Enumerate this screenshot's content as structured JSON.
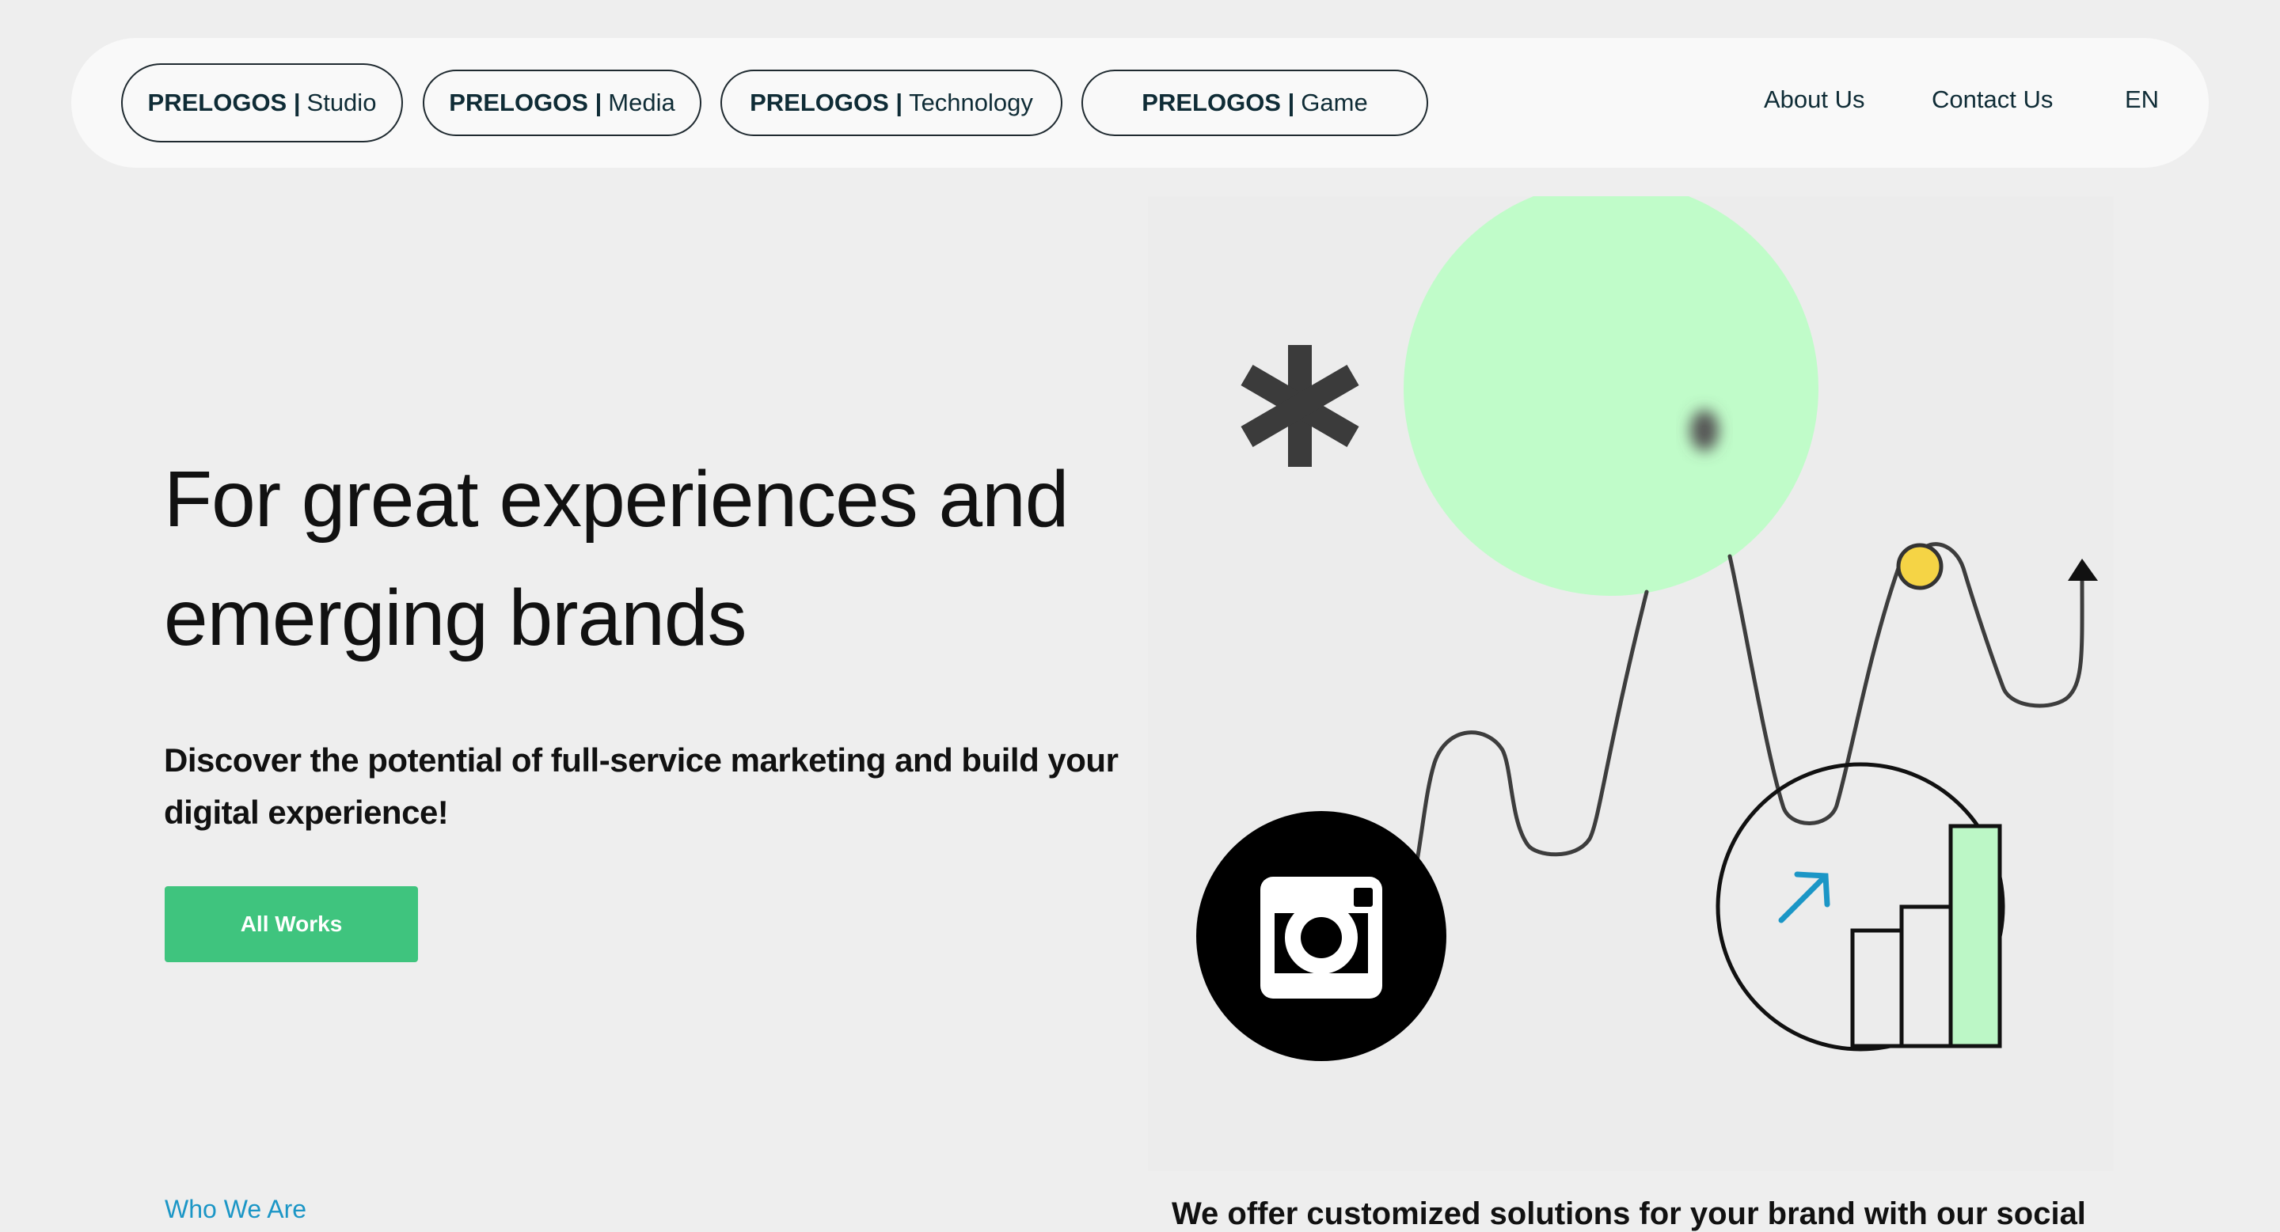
{
  "nav": {
    "pills": [
      {
        "brand": "PRELOGOS |",
        "sub": "Studio"
      },
      {
        "brand": "PRELOGOS |",
        "sub": "Media"
      },
      {
        "brand": "PRELOGOS |",
        "sub": "Technology"
      },
      {
        "brand": "PRELOGOS |",
        "sub": "Game"
      }
    ],
    "about": "About Us",
    "contact": "Contact Us",
    "language": "EN"
  },
  "hero": {
    "title": "For great experiences and emerging brands",
    "subtitle": "Discover the potential of full-service marketing and build your digital experience!",
    "cta_label": "All Works"
  },
  "section": {
    "label": "Who We Are",
    "text": "We offer customized solutions for your brand with our social"
  },
  "colors": {
    "accent_green": "#3fc47e",
    "mint": "#c0fcc9",
    "link_blue": "#1b96c6",
    "text_dark": "#0f2c36",
    "dot_yellow": "#f5d445"
  },
  "illustration": {
    "icons": [
      "asterisk-icon",
      "instagram-icon",
      "arrow-up-right-icon",
      "bar-chart-icon",
      "arrow-up-icon"
    ]
  }
}
